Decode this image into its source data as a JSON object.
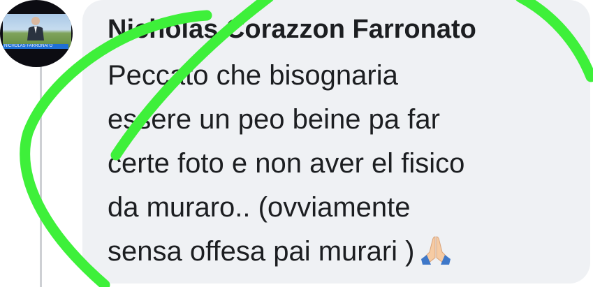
{
  "comment": {
    "author": "Nicholas Corazzon Farronato",
    "lines": [
      "Peccato che bisognaria",
      "essere un peo beine pa far",
      "certe foto e non aver el fisico",
      "da muraro.. (ovviamente",
      "sensa offesa pai murari )"
    ],
    "emoji": "folded-hands-emoji"
  },
  "avatar": {
    "caption": "NICHOLAS FARRONATO"
  },
  "annotation": {
    "color": "#3ef03a"
  }
}
